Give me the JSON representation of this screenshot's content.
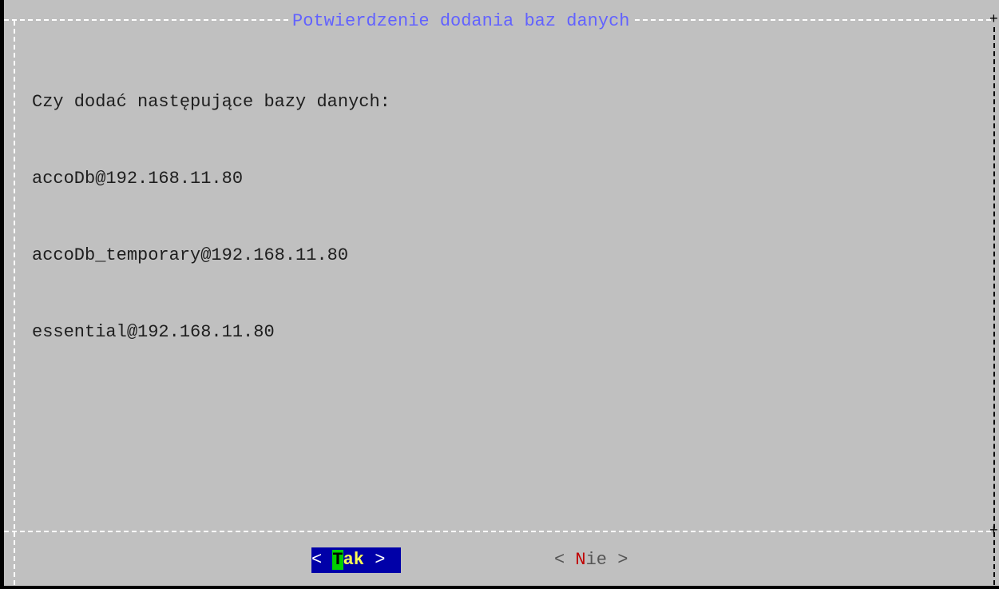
{
  "dialog": {
    "title": "Potwierdzenie dodania baz danych",
    "prompt": "Czy dodać następujące bazy danych:",
    "databases": [
      "accoDb@192.168.11.80",
      "accoDb_temporary@192.168.11.80",
      "essential@192.168.11.80"
    ]
  },
  "buttons": {
    "yes": {
      "open": "< ",
      "hotkey": "T",
      "rest": "ak",
      "close": " >"
    },
    "no": {
      "open": "< ",
      "hotkey": "N",
      "rest": "ie",
      "close": " >"
    }
  },
  "colors": {
    "background": "#c0c0c0",
    "title": "#6262ff",
    "selected_button_bg": "#0000a8",
    "hotkey_highlight": "#00d000",
    "no_hotkey": "#c00000"
  }
}
